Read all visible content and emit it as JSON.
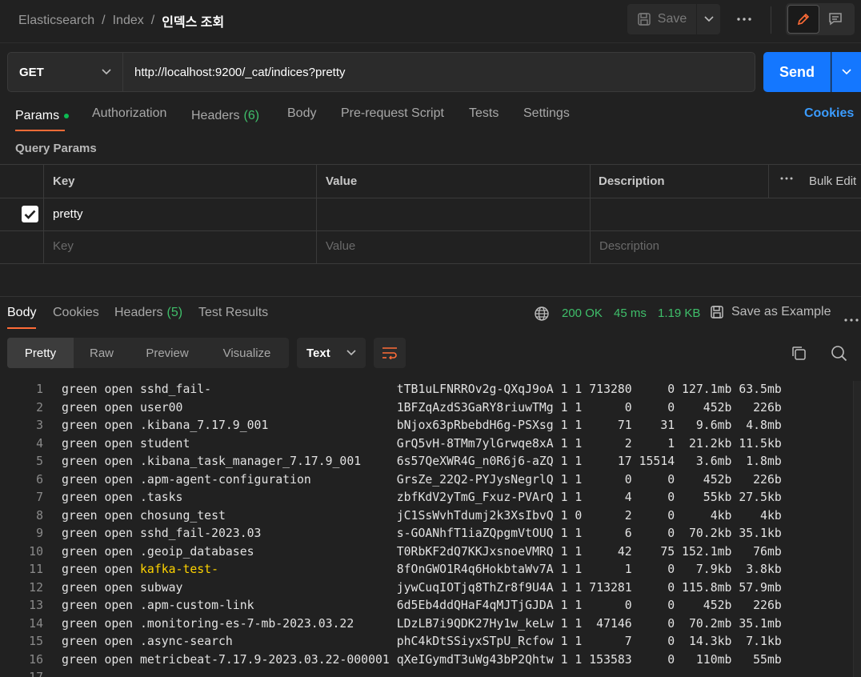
{
  "breadcrumb": {
    "items": [
      "Elasticsearch",
      "Index"
    ],
    "current": "인덱스 조회",
    "separator": "/"
  },
  "toolbar": {
    "save_label": "Save"
  },
  "request": {
    "method": "GET",
    "url": "http://localhost:9200/_cat/indices?pretty",
    "send_label": "Send"
  },
  "request_tabs": {
    "params": "Params",
    "authorization": "Authorization",
    "headers": "Headers",
    "headers_count": "(6)",
    "body": "Body",
    "prerequest": "Pre-request Script",
    "tests": "Tests",
    "settings": "Settings",
    "cookies": "Cookies"
  },
  "query_params": {
    "title": "Query Params",
    "columns": {
      "key": "Key",
      "value": "Value",
      "description": "Description",
      "bulk_edit": "Bulk Edit"
    },
    "row": {
      "key": "pretty",
      "checked": true
    },
    "placeholders": {
      "key": "Key",
      "value": "Value",
      "description": "Description"
    }
  },
  "response_tabs": {
    "body": "Body",
    "cookies": "Cookies",
    "headers": "Headers",
    "headers_count": "(5)",
    "test_results": "Test Results"
  },
  "response_stats": {
    "status": "200 OK",
    "time": "45 ms",
    "size": "1.19 KB",
    "save_example": "Save as Example"
  },
  "format": {
    "modes": [
      "Pretty",
      "Raw",
      "Preview",
      "Visualize"
    ],
    "active": "Pretty",
    "type": "Text"
  },
  "colors": {
    "accent": "#ff6c37",
    "send": "#1477ff",
    "success": "#3fbf6a",
    "link": "#3b9cff",
    "highlight": "#ffd400"
  },
  "code_lines": [
    {
      "n": "1",
      "pre": "green open ",
      "name": "sshd_fail-",
      "rest": "tTB1uLFNRROv2g-QXqJ9oA 1 1 713280     0 127.1mb 63.5mb"
    },
    {
      "n": "2",
      "pre": "green open ",
      "name": "user00",
      "rest": "1BFZqAzdS3GaRY8riuwTMg 1 1      0     0    452b   226b"
    },
    {
      "n": "3",
      "pre": "green open ",
      "name": ".kibana_7.17.9_001",
      "rest": "bNjox63pRbebdH6g-PSXsg 1 1     71    31   9.6mb  4.8mb"
    },
    {
      "n": "4",
      "pre": "green open ",
      "name": "student",
      "rest": "GrQ5vH-8TMm7ylGrwqe8xA 1 1      2     1  21.2kb 11.5kb"
    },
    {
      "n": "5",
      "pre": "green open ",
      "name": ".kibana_task_manager_7.17.9_001",
      "rest": "6s57QeXWR4G_n0R6j6-aZQ 1 1     17 15514   3.6mb  1.8mb"
    },
    {
      "n": "6",
      "pre": "green open ",
      "name": ".apm-agent-configuration",
      "rest": "GrsZe_22Q2-PYJysNegrlQ 1 1      0     0    452b   226b"
    },
    {
      "n": "7",
      "pre": "green open ",
      "name": ".tasks",
      "rest": "zbfKdV2yTmG_Fxuz-PVArQ 1 1      4     0    55kb 27.5kb"
    },
    {
      "n": "8",
      "pre": "green open ",
      "name": "chosung_test",
      "rest": "jC1SsWvhTdumj2k3XsIbvQ 1 0      2     0     4kb    4kb"
    },
    {
      "n": "9",
      "pre": "green open ",
      "name": "sshd_fail-2023.03",
      "rest": "s-GOANhfT1iaZQpgmVtOUQ 1 1      6     0  70.2kb 35.1kb"
    },
    {
      "n": "10",
      "pre": "green open ",
      "name": ".geoip_databases",
      "rest": "T0RbKF2dQ7KKJxsnoeVMRQ 1 1     42    75 152.1mb   76mb"
    },
    {
      "n": "11",
      "pre": "green open ",
      "name": "kafka-test-",
      "rest": "8fOnGWO1R4q6HokbtaWv7A 1 1      1     0   7.9kb  3.8kb",
      "highlight": true
    },
    {
      "n": "12",
      "pre": "green open ",
      "name": "subway",
      "rest": "jywCuqIOTjq8ThZr8f9U4A 1 1 713281     0 115.8mb 57.9mb"
    },
    {
      "n": "13",
      "pre": "green open ",
      "name": ".apm-custom-link",
      "rest": "6d5Eb4ddQHaF4qMJTjGJDA 1 1      0     0    452b   226b"
    },
    {
      "n": "14",
      "pre": "green open ",
      "name": ".monitoring-es-7-mb-2023.03.22",
      "rest": "LDzLB7i9QDK27Hy1w_keLw 1 1  47146     0  70.2mb 35.1mb"
    },
    {
      "n": "15",
      "pre": "green open ",
      "name": ".async-search",
      "rest": "phC4kDtSSiyxSTpU_Rcfow 1 1      7     0  14.3kb  7.1kb"
    },
    {
      "n": "16",
      "pre": "green open ",
      "name": "metricbeat-7.17.9-2023.03.22-000001",
      "rest": "qXeIGymdT3uWg43bP2Qhtw 1 1 153583     0   110mb   55mb"
    },
    {
      "n": "17",
      "pre": "",
      "name": "",
      "rest": ""
    }
  ]
}
